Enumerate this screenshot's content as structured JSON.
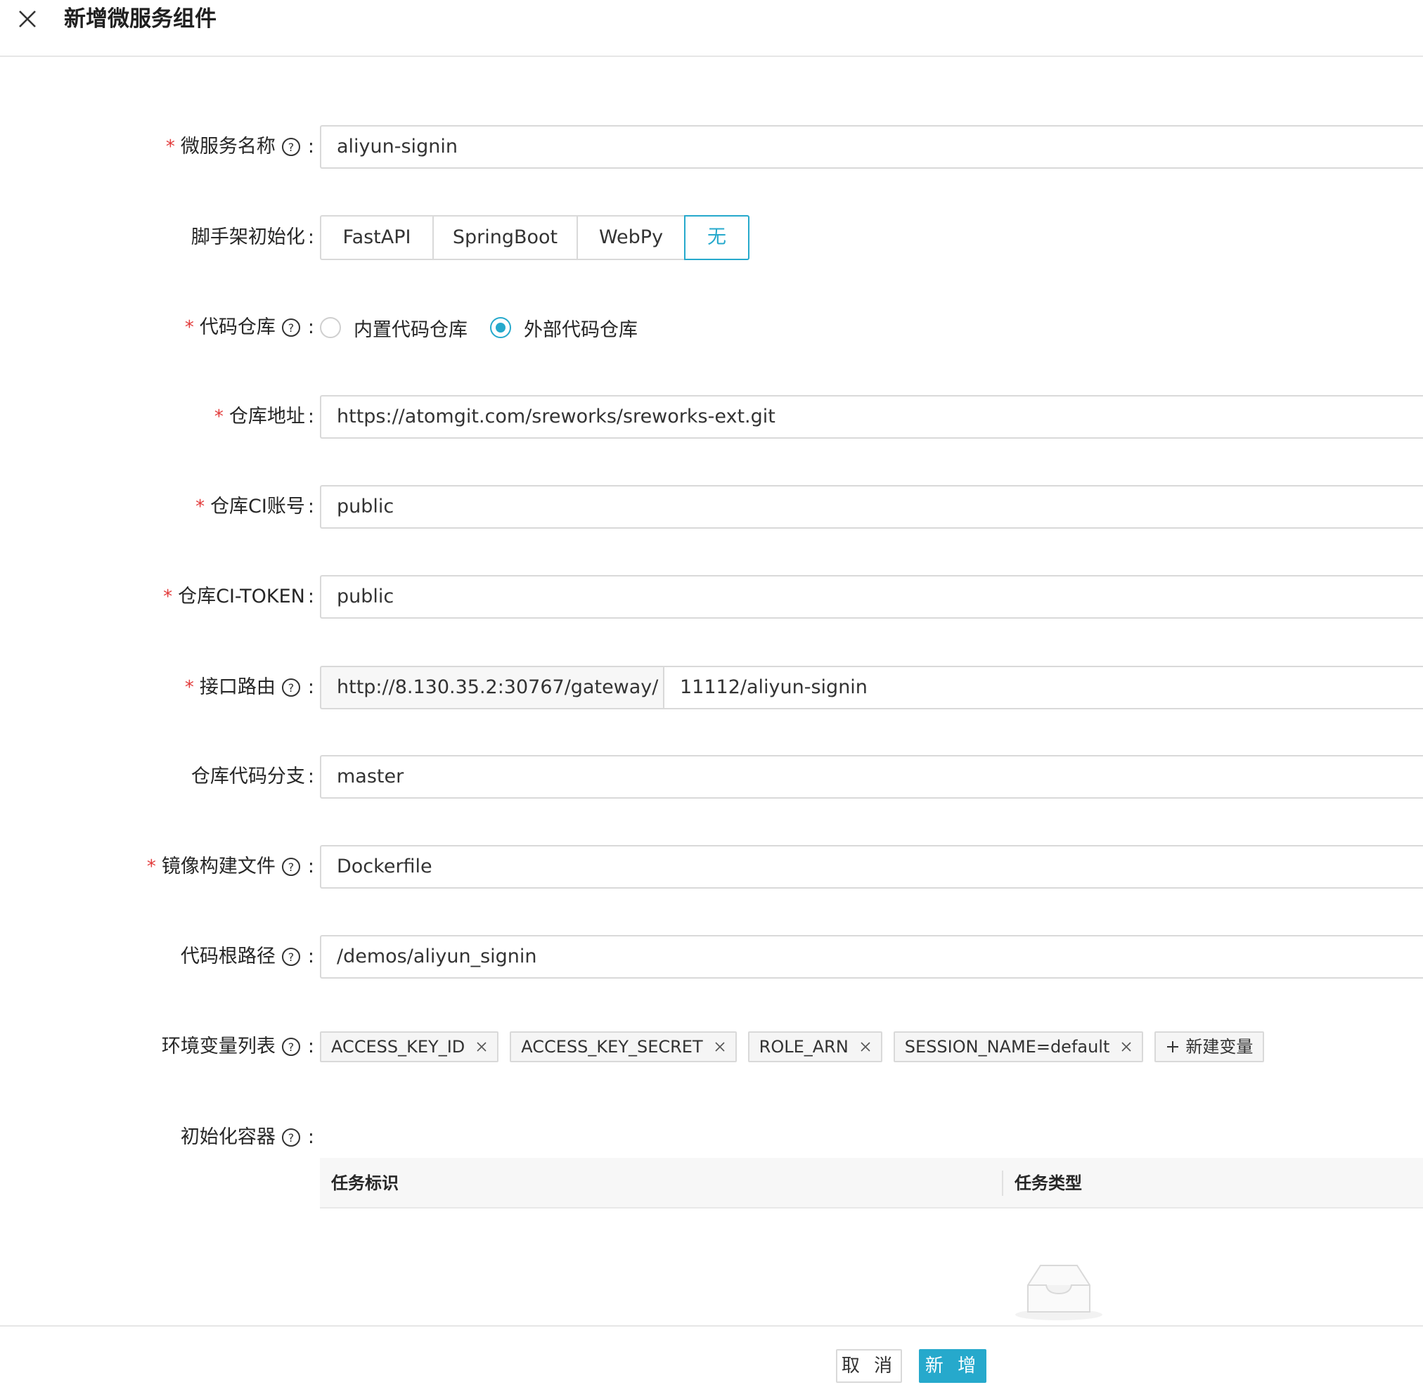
{
  "header": {
    "title": "新增微服务组件"
  },
  "form": {
    "service_name": {
      "label": "微服务名称",
      "value": "aliyun-signin"
    },
    "scaffold": {
      "label": "脚手架初始化",
      "options": [
        "FastAPI",
        "SpringBoot",
        "WebPy",
        "无"
      ],
      "selected": "无"
    },
    "code_repo": {
      "label": "代码仓库",
      "options": [
        "内置代码仓库",
        "外部代码仓库"
      ],
      "selected": "外部代码仓库"
    },
    "repo_url": {
      "label": "仓库地址",
      "value": "https://atomgit.com/sreworks/sreworks-ext.git"
    },
    "repo_ci_account": {
      "label": "仓库CI账号",
      "value": "public"
    },
    "repo_ci_token": {
      "label": "仓库CI-TOKEN",
      "value": "public"
    },
    "api_route": {
      "label": "接口路由",
      "prefix": "http://8.130.35.2:30767/gateway/",
      "value": "11112/aliyun-signin"
    },
    "repo_branch": {
      "label": "仓库代码分支",
      "value": "master"
    },
    "dockerfile": {
      "label": "镜像构建文件",
      "value": "Dockerfile"
    },
    "code_root": {
      "label": "代码根路径",
      "value": "/demos/aliyun_signin"
    },
    "env_vars": {
      "label": "环境变量列表",
      "tags": [
        "ACCESS_KEY_ID",
        "ACCESS_KEY_SECRET",
        "ROLE_ARN",
        "SESSION_NAME=default"
      ],
      "add_label": "新建变量"
    },
    "init_containers": {
      "label": "初始化容器",
      "columns": [
        "任务标识",
        "任务类型"
      ]
    }
  },
  "footer": {
    "cancel_label": "取 消",
    "submit_label": "新 增"
  },
  "colors": {
    "accent": "#26a9cc",
    "required": "#e23b3b"
  }
}
